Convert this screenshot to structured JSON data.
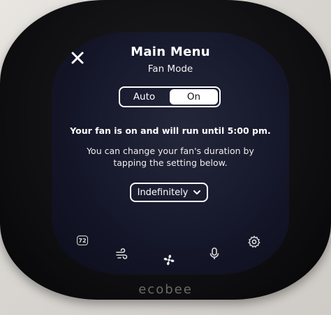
{
  "header": {
    "title": "Main Menu",
    "subtitle": "Fan Mode",
    "close_icon": "close-icon"
  },
  "mode_toggle": {
    "options": [
      "Auto",
      "On"
    ],
    "selected": "On"
  },
  "status_message": "Your fan is on and will run until 5:00 pm.",
  "hint_message": "You can change your fan's duration by tapping the setting below.",
  "duration_select": {
    "value": "Indefinitely",
    "icon": "chevron-down-icon"
  },
  "bottom_nav": {
    "temperature": "72",
    "icons": [
      "thermometer-badge-icon",
      "airflow-icon",
      "fan-icon",
      "microphone-icon",
      "settings-gear-icon"
    ]
  },
  "brand": "ecobee",
  "colors": {
    "screen_bg": "#15172a",
    "text": "#ffffff",
    "selected_segment": "#ffffff"
  }
}
